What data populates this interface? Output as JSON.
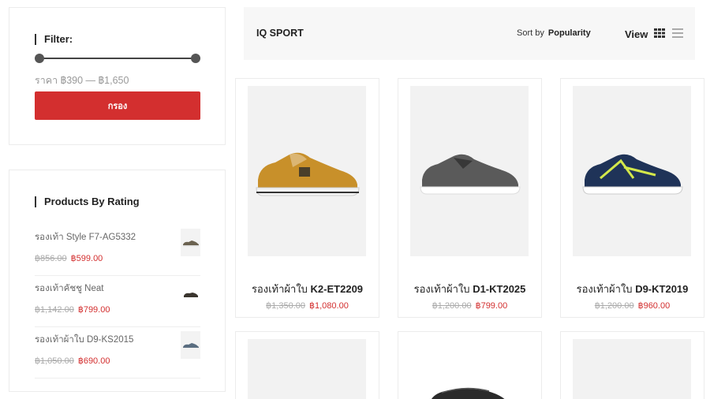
{
  "filter": {
    "title": "Filter:",
    "price_label": "ราคา ฿390 — ฿1,650",
    "button_label": "กรอง",
    "range_min_fraction": 0.0,
    "range_max_fraction": 1.0
  },
  "rating_widget": {
    "title": "Products By Rating",
    "items": [
      {
        "name": "รองเท้า Style F7-AG5332",
        "old_price": "฿856.00",
        "new_price": "฿599.00"
      },
      {
        "name": "รองเท้าคัชชู Neat",
        "old_price": "฿1,142.00",
        "new_price": "฿799.00"
      },
      {
        "name": "รองเท้าผ้าใบ D9-KS2015",
        "old_price": "฿1,050.00",
        "new_price": "฿690.00"
      }
    ]
  },
  "toolbar": {
    "brand": "IQ SPORT",
    "sort_prefix": "Sort by",
    "sort_value": "Popularity",
    "view_label": "View"
  },
  "products": [
    {
      "name_prefix": "รองเท้าผ้าใบ",
      "model": "K2-ET2209",
      "old_price": "฿1,350.00",
      "new_price": "฿1,080.00",
      "shoe_color": "#c8902a"
    },
    {
      "name_prefix": "รองเท้าผ้าใบ",
      "model": "D1-KT2025",
      "old_price": "฿1,200.00",
      "new_price": "฿799.00",
      "shoe_color": "#5a5a5a"
    },
    {
      "name_prefix": "รองเท้าผ้าใบ",
      "model": "D9-KT2019",
      "old_price": "฿1,200.00",
      "new_price": "฿960.00",
      "shoe_color": "#1f3358"
    }
  ],
  "colors": {
    "accent": "#d32f2f",
    "toolbar_bg": "#f7f7f7",
    "image_bg": "#f2f2f2"
  }
}
